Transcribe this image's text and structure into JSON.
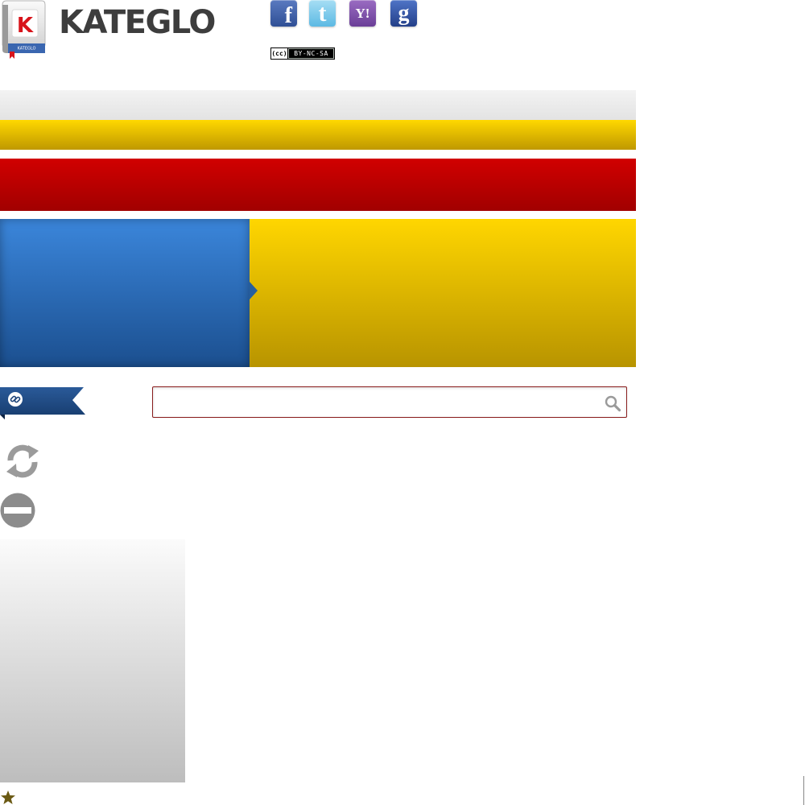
{
  "brand": {
    "name": "KATEGLO",
    "book_letter": "K",
    "book_label": "KATEGLO",
    "colors": {
      "logo_text": "#3d3d3d",
      "book_red": "#d8141b",
      "book_blue": "#3a66b0"
    }
  },
  "social": [
    {
      "name": "facebook",
      "glyph": "f",
      "color": "#3b5998"
    },
    {
      "name": "twitter",
      "glyph": "t",
      "color": "#5cb9e3"
    },
    {
      "name": "yahoo",
      "glyph": "Y!",
      "color": "#7b4fa8"
    },
    {
      "name": "google",
      "glyph": "g",
      "color": "#2f52a5"
    }
  ],
  "license": {
    "cc": "(cc)",
    "terms": "BY-NC-SA"
  },
  "theme": {
    "band_gray": "#e8e8e8",
    "band_yellow": "#f2c800",
    "band_red": "#c00000",
    "panel_blue": "#2b6dbf",
    "panel_yellow": "#e8c000",
    "search_border": "#8a1d1d"
  },
  "icons": {
    "ribbon": "link-icon",
    "search": "search-icon",
    "refresh": "refresh-icon",
    "minus": "minus-icon",
    "star": "star-icon"
  },
  "search": {
    "value": "",
    "placeholder": ""
  }
}
